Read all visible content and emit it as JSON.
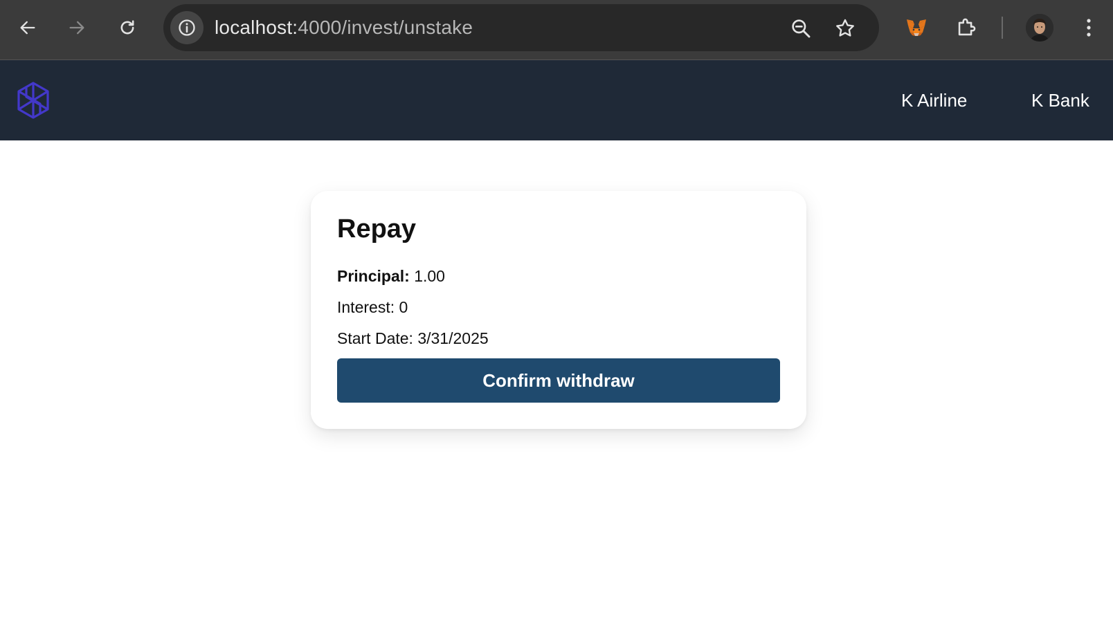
{
  "browser": {
    "url_host": "localhost:",
    "url_path": "4000/invest/unstake",
    "icons": {
      "back": "back-arrow-icon",
      "forward": "forward-arrow-icon",
      "reload": "reload-icon",
      "site_info": "info-icon",
      "zoom": "zoom-out-icon",
      "bookmark": "star-icon",
      "metamask": "metamask-fox-icon",
      "extensions": "puzzle-icon",
      "profile": "avatar",
      "menu": "kebab-menu-icon"
    }
  },
  "header": {
    "logo": "app-logo-icon",
    "links": [
      "K Airline",
      "K Bank"
    ],
    "background": "#1f2937"
  },
  "card": {
    "title": "Repay",
    "principal_label": "Principal:",
    "principal_value": "1.00",
    "interest": "Interest: 0",
    "start_date": "Start Date: 3/31/2025",
    "confirm_label": "Confirm withdraw",
    "button_color": "#1f4a6e"
  }
}
